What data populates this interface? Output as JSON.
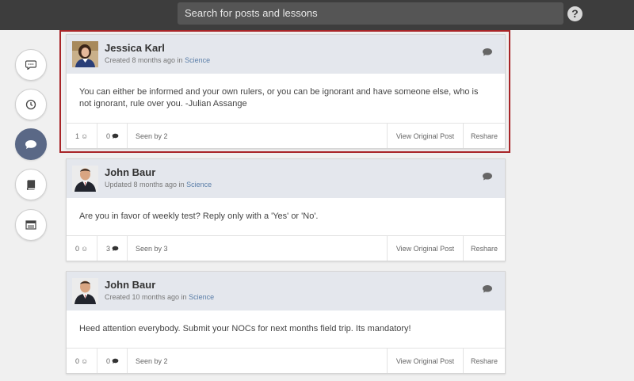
{
  "header": {
    "search_placeholder": "Search for posts and lessons",
    "help_label": "?"
  },
  "sidebar": {
    "items": [
      {
        "icon": "chat-bubble-icon",
        "active": false
      },
      {
        "icon": "clock-icon",
        "active": false
      },
      {
        "icon": "chat-bubble-icon",
        "active": true
      },
      {
        "icon": "book-icon",
        "active": false
      },
      {
        "icon": "calendar-icon",
        "active": false
      }
    ]
  },
  "colors": {
    "topbar": "#3d3d3d",
    "active_sidebar": "#5a6886",
    "card_header": "#e4e7ed",
    "highlight_border": "#a82528",
    "link": "#5a7ea8"
  },
  "posts": [
    {
      "author": "Jessica Karl",
      "status": "Created 8 months ago in",
      "category": "Science",
      "body": "You can either be informed and your own rulers, or you can be ignorant and have someone else, who is not ignorant, rule over you. -Julian Assange",
      "likes": "1",
      "comments": "0",
      "seen": "Seen by 2",
      "view_label": "View Original Post",
      "reshare_label": "Reshare"
    },
    {
      "author": "John Baur",
      "status": "Updated 8 months ago in",
      "category": "Science",
      "body": "Are you in favor of weekly test? Reply only with a 'Yes' or 'No'.",
      "likes": "0",
      "comments": "3",
      "seen": "Seen by 3",
      "view_label": "View Original Post",
      "reshare_label": "Reshare"
    },
    {
      "author": "John Baur",
      "status": "Created 10 months ago in",
      "category": "Science",
      "body": "Heed attention everybody. Submit your NOCs for next months field trip. Its mandatory!",
      "likes": "0",
      "comments": "0",
      "seen": "Seen by 2",
      "view_label": "View Original Post",
      "reshare_label": "Reshare"
    }
  ]
}
